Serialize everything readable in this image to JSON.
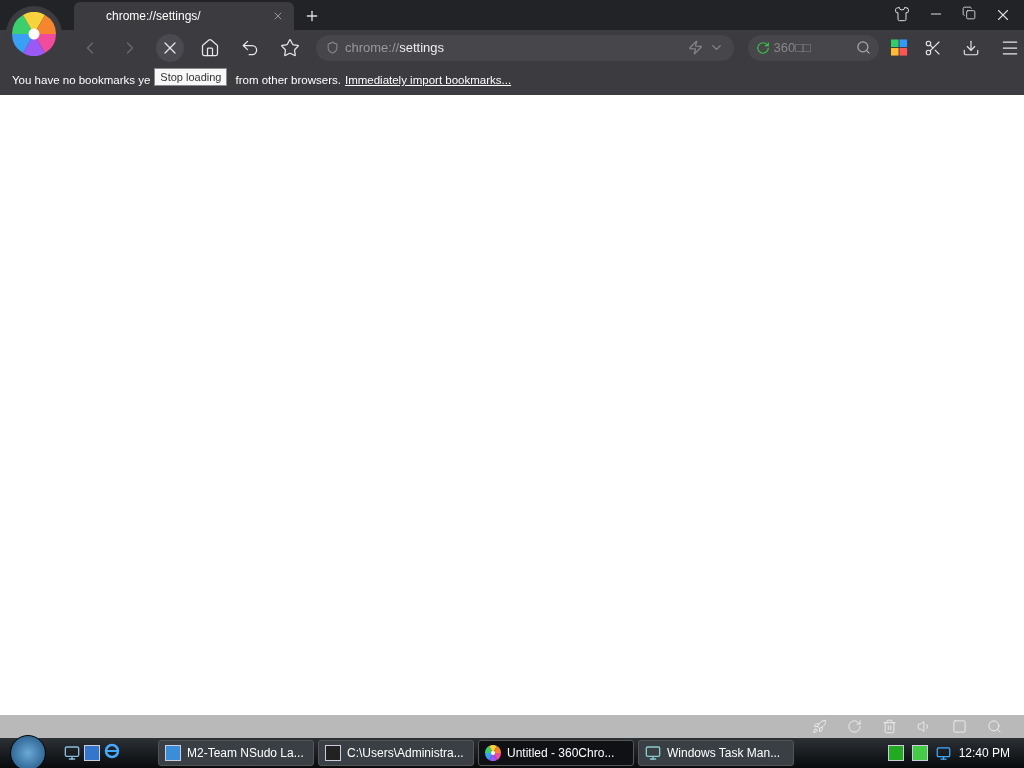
{
  "tabs": [
    {
      "title": "chrome://settings/",
      "selected": true
    }
  ],
  "toolbar": {
    "back_disabled": true,
    "forward_disabled": true,
    "address_scheme": "chrome://",
    "address_path": "settings",
    "search_placeholder": "360□□"
  },
  "tooltip": "Stop loading",
  "bookmark_bar": {
    "text_start": "You have no bookmarks ye",
    "text_end": "from other browsers.",
    "link": "Immediately import bookmarks..."
  },
  "taskbar": {
    "buttons": [
      {
        "label": "M2-Team NSudo La...",
        "selected": false,
        "kind": "app"
      },
      {
        "label": "C:\\Users\\Administra...",
        "selected": false,
        "kind": "zip"
      },
      {
        "label": "Untitled - 360Chro...",
        "selected": true,
        "kind": "browser"
      },
      {
        "label": "Windows Task Man...",
        "selected": false,
        "kind": "monitor"
      }
    ],
    "clock": "12:40 PM"
  }
}
